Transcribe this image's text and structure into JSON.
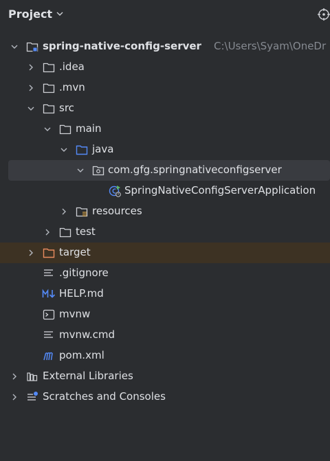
{
  "header": {
    "title": "Project",
    "chevron_icon": "chevron-down-icon",
    "locate_icon": "crosshair-icon"
  },
  "tree": {
    "root": {
      "name": "spring-native-config-server",
      "path": "C:\\Users\\Syam\\OneDr"
    },
    "idea": ".idea",
    "mvn": ".mvn",
    "src": "src",
    "main": "main",
    "java": "java",
    "package": "com.gfg.springnativeconfigserver",
    "app_class": "SpringNativeConfigServerApplication",
    "resources": "resources",
    "test": "test",
    "target": "target",
    "gitignore": ".gitignore",
    "help": "HELP.md",
    "mvnw": "mvnw",
    "mvnw_cmd": "mvnw.cmd",
    "pom": "pom.xml",
    "external_libs": "External Libraries",
    "scratches": "Scratches and Consoles"
  },
  "colors": {
    "background": "#2b2d30",
    "selected_row": "#393b40",
    "excluded_row": "#3d3223",
    "source_folder": "#548af7",
    "excluded_folder": "#e98b5f",
    "markdown": "#548af7",
    "maven": "#548af7"
  }
}
